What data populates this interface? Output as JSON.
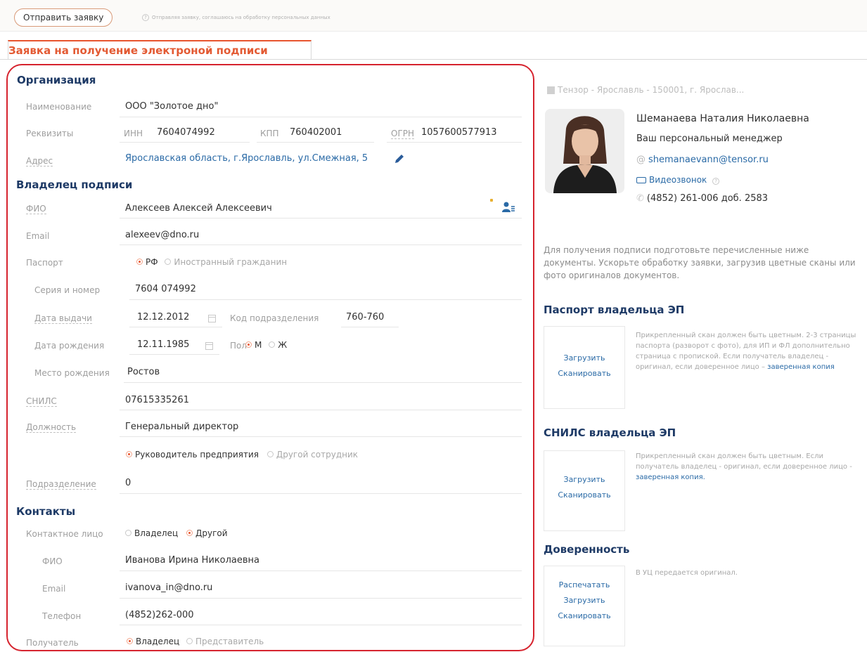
{
  "toolbar": {
    "send_label": "Отправить заявку",
    "consent_text": "Отправляя заявку, соглашаюсь на обработку персональных данных"
  },
  "tab": {
    "title": "Заявка на получение электроной подписи"
  },
  "org": {
    "heading": "Организация",
    "name_label": "Наименование",
    "name_value": "ООО \"Золотое дно\"",
    "req_label": "Реквизиты",
    "inn_label": "ИНН",
    "inn_value": "7604074992",
    "kpp_label": "КПП",
    "kpp_value": "760402001",
    "ogrn_label": "ОГРН",
    "ogrn_value": "1057600577913",
    "addr_label": "Адрес",
    "addr_value": "Ярославская область, г.Ярославль, ул.Смежная, 5"
  },
  "owner": {
    "heading": "Владелец подписи",
    "fio_label": "ФИО",
    "fio_value": "Алексеев Алексей Алексеевич",
    "email_label": "Email",
    "email_value": "alexeev@dno.ru",
    "passport_label": "Паспорт",
    "passport_rf": "РФ",
    "passport_foreign": "Иностранный гражданин",
    "series_label": "Серия и номер",
    "series_value": "7604 074992",
    "issue_label": "Дата выдачи",
    "issue_value": "12.12.2012",
    "dept_code_label": "Код подразделения",
    "dept_code_value": "760-760",
    "birth_label": "Дата рождения",
    "birth_value": "12.11.1985",
    "sex_label": "Пол",
    "sex_m": "М",
    "sex_f": "Ж",
    "birthplace_label": "Место рождения",
    "birthplace_value": "Ростов",
    "snils_label": "СНИЛС",
    "snils_value": "07615335261",
    "position_label": "Должность",
    "position_value": "Генеральный директор",
    "role_head": "Руководитель предприятия",
    "role_other": "Другой сотрудник",
    "subdiv_label": "Подразделение",
    "subdiv_value": "0"
  },
  "contacts": {
    "heading": "Контакты",
    "person_label": "Контактное лицо",
    "person_owner": "Владелец",
    "person_other": "Другой",
    "fio_label": "ФИО",
    "fio_value": "Иванова Ирина Николаевна",
    "email_label": "Email",
    "email_value": "ivanova_in@dno.ru",
    "phone_label": "Телефон",
    "phone_value": "(4852)262-000",
    "recipient_label": "Получатель",
    "recipient_owner": "Владелец",
    "recipient_rep": "Представитель"
  },
  "manager": {
    "company": "Тензор - Ярославль - 150001, г. Ярослав...",
    "name": "Шеманаева Наталия Николаевна",
    "role": "Ваш персональный менеджер",
    "email": "shemanaevann@tensor.ru",
    "video": "Видеозвонок",
    "phone": "(4852) 261-006 доб. 2583"
  },
  "docs": {
    "hint": "Для получения подписи подготовьте перечисленные ниже документы. Ускорьте обработку заявки, загрузив цветные сканы или фото оригиналов документов.",
    "passport_heading": "Паспорт владельца ЭП",
    "passport_desc": "Прикрепленный скан должен быть цветным. 2-3 страницы паспорта (разворот с фото), для ИП и ФЛ дополнительно страница с пропиской. Если получатель владелец - оригинал, если доверенное лицо –",
    "passport_link": "заверенная копия",
    "snils_heading": "СНИЛС владельца ЭП",
    "snils_desc": "Прикрепленный скан должен быть цветным. Если получатель владелец - оригинал, если доверенное лицо -",
    "snils_link": "заверенная копия.",
    "proxy_heading": "Доверенность",
    "proxy_desc": "В УЦ передается оригинал.",
    "upload": "Загрузить",
    "scan": "Сканировать",
    "print": "Распечатать"
  }
}
